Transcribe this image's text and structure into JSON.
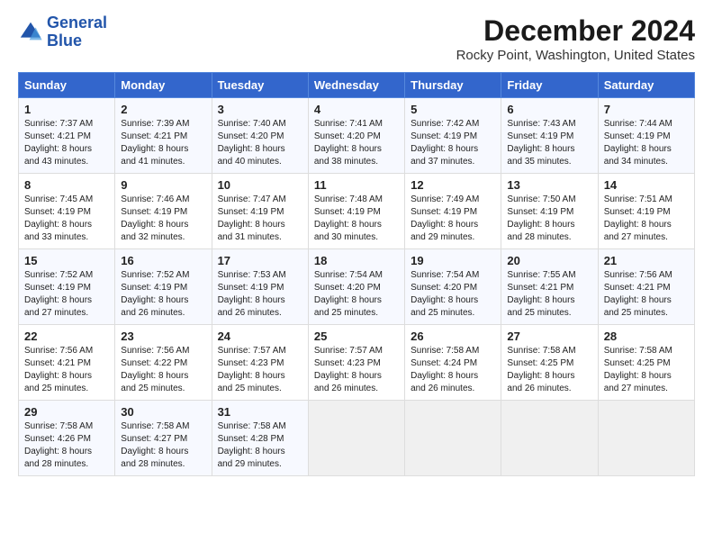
{
  "logo": {
    "line1": "General",
    "line2": "Blue"
  },
  "title": "December 2024",
  "location": "Rocky Point, Washington, United States",
  "days_of_week": [
    "Sunday",
    "Monday",
    "Tuesday",
    "Wednesday",
    "Thursday",
    "Friday",
    "Saturday"
  ],
  "weeks": [
    [
      {
        "num": "1",
        "sunrise": "Sunrise: 7:37 AM",
        "sunset": "Sunset: 4:21 PM",
        "daylight": "Daylight: 8 hours and 43 minutes."
      },
      {
        "num": "2",
        "sunrise": "Sunrise: 7:39 AM",
        "sunset": "Sunset: 4:21 PM",
        "daylight": "Daylight: 8 hours and 41 minutes."
      },
      {
        "num": "3",
        "sunrise": "Sunrise: 7:40 AM",
        "sunset": "Sunset: 4:20 PM",
        "daylight": "Daylight: 8 hours and 40 minutes."
      },
      {
        "num": "4",
        "sunrise": "Sunrise: 7:41 AM",
        "sunset": "Sunset: 4:20 PM",
        "daylight": "Daylight: 8 hours and 38 minutes."
      },
      {
        "num": "5",
        "sunrise": "Sunrise: 7:42 AM",
        "sunset": "Sunset: 4:19 PM",
        "daylight": "Daylight: 8 hours and 37 minutes."
      },
      {
        "num": "6",
        "sunrise": "Sunrise: 7:43 AM",
        "sunset": "Sunset: 4:19 PM",
        "daylight": "Daylight: 8 hours and 35 minutes."
      },
      {
        "num": "7",
        "sunrise": "Sunrise: 7:44 AM",
        "sunset": "Sunset: 4:19 PM",
        "daylight": "Daylight: 8 hours and 34 minutes."
      }
    ],
    [
      {
        "num": "8",
        "sunrise": "Sunrise: 7:45 AM",
        "sunset": "Sunset: 4:19 PM",
        "daylight": "Daylight: 8 hours and 33 minutes."
      },
      {
        "num": "9",
        "sunrise": "Sunrise: 7:46 AM",
        "sunset": "Sunset: 4:19 PM",
        "daylight": "Daylight: 8 hours and 32 minutes."
      },
      {
        "num": "10",
        "sunrise": "Sunrise: 7:47 AM",
        "sunset": "Sunset: 4:19 PM",
        "daylight": "Daylight: 8 hours and 31 minutes."
      },
      {
        "num": "11",
        "sunrise": "Sunrise: 7:48 AM",
        "sunset": "Sunset: 4:19 PM",
        "daylight": "Daylight: 8 hours and 30 minutes."
      },
      {
        "num": "12",
        "sunrise": "Sunrise: 7:49 AM",
        "sunset": "Sunset: 4:19 PM",
        "daylight": "Daylight: 8 hours and 29 minutes."
      },
      {
        "num": "13",
        "sunrise": "Sunrise: 7:50 AM",
        "sunset": "Sunset: 4:19 PM",
        "daylight": "Daylight: 8 hours and 28 minutes."
      },
      {
        "num": "14",
        "sunrise": "Sunrise: 7:51 AM",
        "sunset": "Sunset: 4:19 PM",
        "daylight": "Daylight: 8 hours and 27 minutes."
      }
    ],
    [
      {
        "num": "15",
        "sunrise": "Sunrise: 7:52 AM",
        "sunset": "Sunset: 4:19 PM",
        "daylight": "Daylight: 8 hours and 27 minutes."
      },
      {
        "num": "16",
        "sunrise": "Sunrise: 7:52 AM",
        "sunset": "Sunset: 4:19 PM",
        "daylight": "Daylight: 8 hours and 26 minutes."
      },
      {
        "num": "17",
        "sunrise": "Sunrise: 7:53 AM",
        "sunset": "Sunset: 4:19 PM",
        "daylight": "Daylight: 8 hours and 26 minutes."
      },
      {
        "num": "18",
        "sunrise": "Sunrise: 7:54 AM",
        "sunset": "Sunset: 4:20 PM",
        "daylight": "Daylight: 8 hours and 25 minutes."
      },
      {
        "num": "19",
        "sunrise": "Sunrise: 7:54 AM",
        "sunset": "Sunset: 4:20 PM",
        "daylight": "Daylight: 8 hours and 25 minutes."
      },
      {
        "num": "20",
        "sunrise": "Sunrise: 7:55 AM",
        "sunset": "Sunset: 4:21 PM",
        "daylight": "Daylight: 8 hours and 25 minutes."
      },
      {
        "num": "21",
        "sunrise": "Sunrise: 7:56 AM",
        "sunset": "Sunset: 4:21 PM",
        "daylight": "Daylight: 8 hours and 25 minutes."
      }
    ],
    [
      {
        "num": "22",
        "sunrise": "Sunrise: 7:56 AM",
        "sunset": "Sunset: 4:21 PM",
        "daylight": "Daylight: 8 hours and 25 minutes."
      },
      {
        "num": "23",
        "sunrise": "Sunrise: 7:56 AM",
        "sunset": "Sunset: 4:22 PM",
        "daylight": "Daylight: 8 hours and 25 minutes."
      },
      {
        "num": "24",
        "sunrise": "Sunrise: 7:57 AM",
        "sunset": "Sunset: 4:23 PM",
        "daylight": "Daylight: 8 hours and 25 minutes."
      },
      {
        "num": "25",
        "sunrise": "Sunrise: 7:57 AM",
        "sunset": "Sunset: 4:23 PM",
        "daylight": "Daylight: 8 hours and 26 minutes."
      },
      {
        "num": "26",
        "sunrise": "Sunrise: 7:58 AM",
        "sunset": "Sunset: 4:24 PM",
        "daylight": "Daylight: 8 hours and 26 minutes."
      },
      {
        "num": "27",
        "sunrise": "Sunrise: 7:58 AM",
        "sunset": "Sunset: 4:25 PM",
        "daylight": "Daylight: 8 hours and 26 minutes."
      },
      {
        "num": "28",
        "sunrise": "Sunrise: 7:58 AM",
        "sunset": "Sunset: 4:25 PM",
        "daylight": "Daylight: 8 hours and 27 minutes."
      }
    ],
    [
      {
        "num": "29",
        "sunrise": "Sunrise: 7:58 AM",
        "sunset": "Sunset: 4:26 PM",
        "daylight": "Daylight: 8 hours and 28 minutes."
      },
      {
        "num": "30",
        "sunrise": "Sunrise: 7:58 AM",
        "sunset": "Sunset: 4:27 PM",
        "daylight": "Daylight: 8 hours and 28 minutes."
      },
      {
        "num": "31",
        "sunrise": "Sunrise: 7:58 AM",
        "sunset": "Sunset: 4:28 PM",
        "daylight": "Daylight: 8 hours and 29 minutes."
      },
      null,
      null,
      null,
      null
    ]
  ]
}
